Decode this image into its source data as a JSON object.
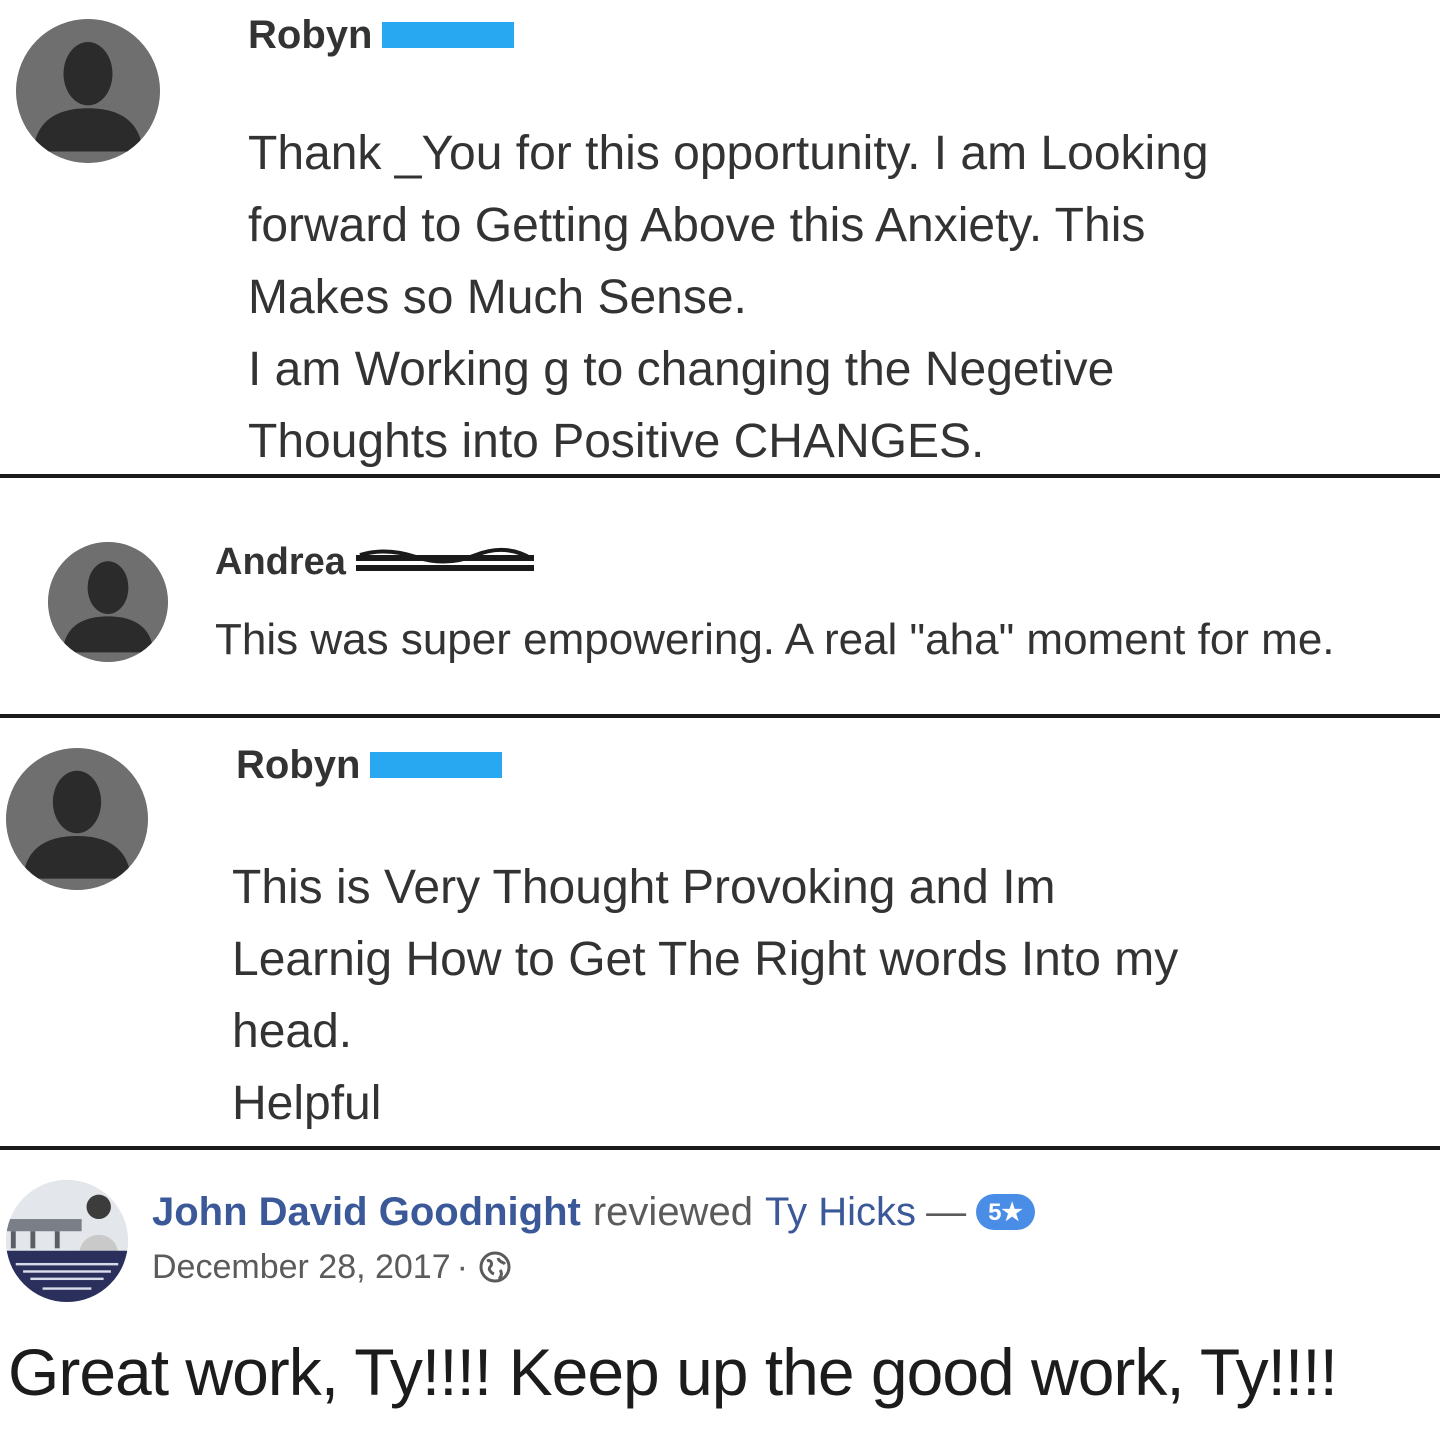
{
  "comments": [
    {
      "first_name": "Robyn",
      "text": "Thank _You for this opportunity. I am Looking\nforward to Getting Above this Anxiety. This\nMakes so Much Sense.\nI am Working g to changing the Negetive\nThoughts into Positive CHANGES."
    },
    {
      "first_name": "Andrea",
      "text": "This was super empowering. A real \"aha\" moment for me."
    },
    {
      "first_name": "Robyn",
      "text": "This is Very Thought Provoking and Im\nLearnig How to Get The Right words Into my\nhead.\nHelpful"
    }
  ],
  "review": {
    "reviewer": "John David Goodnight",
    "verb": "reviewed",
    "target": "Ty Hicks",
    "separator": "—",
    "rating_label": "5★",
    "date": "December 28, 2017",
    "date_separator": "·",
    "privacy_icon": "globe-icon",
    "text": "Great work, Ty!!!! Keep up the good work, Ty!!!!"
  },
  "colors": {
    "link": "#3b5998",
    "rating_badge": "#4a8de6",
    "redaction_blue": "#29a8f2",
    "avatar_bg": "#6f6f6f",
    "avatar_silhouette": "#2b2b2b"
  }
}
